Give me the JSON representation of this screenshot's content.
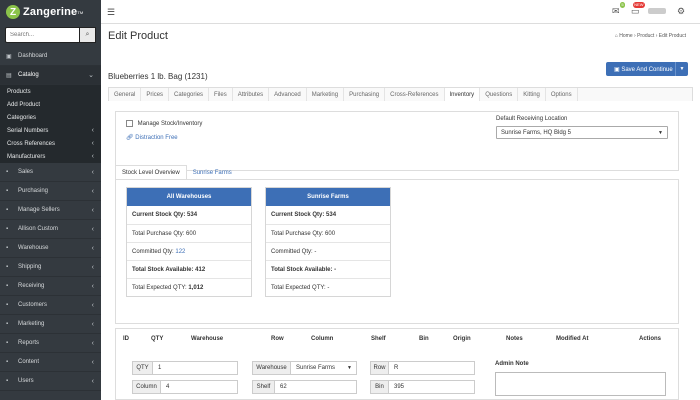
{
  "app": {
    "name": "Zangerine",
    "tm": "TM",
    "logo_letter": "Z"
  },
  "topbar": {
    "menu_icon": "hamburger-icon",
    "mail_badge": "5",
    "chat_badge": "NEW",
    "settings_icon": "gear-icon"
  },
  "sidebar": {
    "search_placeholder": "Search...",
    "items": [
      {
        "label": "Dashboard",
        "icon": "dashboard-icon"
      },
      {
        "label": "Catalog",
        "icon": "catalog-icon",
        "expanded": true,
        "sub": [
          {
            "label": "Products"
          },
          {
            "label": "Add Product"
          },
          {
            "label": "Categories"
          },
          {
            "label": "Serial Numbers"
          },
          {
            "label": "Cross References"
          },
          {
            "label": "Manufacturers"
          }
        ]
      },
      {
        "label": "Sales"
      },
      {
        "label": "Purchasing"
      },
      {
        "label": "Manage Sellers"
      },
      {
        "label": "Allison Custom"
      },
      {
        "label": "Warehouse"
      },
      {
        "label": "Shipping"
      },
      {
        "label": "Receiving"
      },
      {
        "label": "Customers"
      },
      {
        "label": "Marketing"
      },
      {
        "label": "Reports"
      },
      {
        "label": "Content"
      },
      {
        "label": "Users"
      }
    ]
  },
  "page": {
    "title": "Edit Product",
    "breadcrumb": {
      "home": "Home",
      "product": "Product",
      "current": "Edit Product"
    },
    "save_button": "Save And Continue",
    "product_name": "Blueberries 1 lb. Bag (1231)"
  },
  "tabs": [
    "General",
    "Prices",
    "Categories",
    "Files",
    "Attributes",
    "Advanced",
    "Marketing",
    "Purchasing",
    "Cross-References",
    "Inventory",
    "Questions",
    "Kitting",
    "Options"
  ],
  "active_tab": "Inventory",
  "inventory": {
    "manage_stock_label": "Manage Stock/Inventory",
    "distraction_link": "Distraction Free",
    "default_location_label": "Default Receiving Location",
    "default_location_value": "Sunrise Farms, HQ Bldg 5"
  },
  "stock_tabs": [
    "Stock Level Overview",
    "Sunrise Farms"
  ],
  "warehouses": [
    {
      "name": "All Warehouses",
      "current_label": "Current Stock Qty:",
      "current": "534",
      "purchase_label": "Total Purchase Qty:",
      "purchase": "600",
      "committed_label": "Committed Qty:",
      "committed": "122",
      "available_label": "Total Stock Available:",
      "available": "412",
      "expected_label": "Total Expected QTY:",
      "expected": "1,012"
    },
    {
      "name": "Sunrise Farms",
      "current_label": "Current Stock Qty:",
      "current": "534",
      "purchase_label": "Total Purchase Qty:",
      "purchase": "600",
      "committed_label": "Committed Qty:",
      "committed": "-",
      "available_label": "Total Stock Available:",
      "available": "-",
      "expected_label": "Total Expected QTY:",
      "expected": "-"
    }
  ],
  "table": {
    "headers": [
      "ID",
      "QTY",
      "Warehouse",
      "Row",
      "Column",
      "Shelf",
      "Bin",
      "Origin",
      "Notes",
      "Modified At",
      "Actions"
    ]
  },
  "form": {
    "qty_label": "QTY",
    "qty_value": "1",
    "column_label": "Column",
    "column_value": "4",
    "warehouse_label": "Warehouse",
    "warehouse_value": "Sunrise Farms",
    "shelf_label": "Shelf",
    "shelf_value": "62",
    "row_label": "Row",
    "row_value": "R",
    "bin_label": "Bin",
    "bin_value": "395",
    "admin_note_label": "Admin Note"
  }
}
